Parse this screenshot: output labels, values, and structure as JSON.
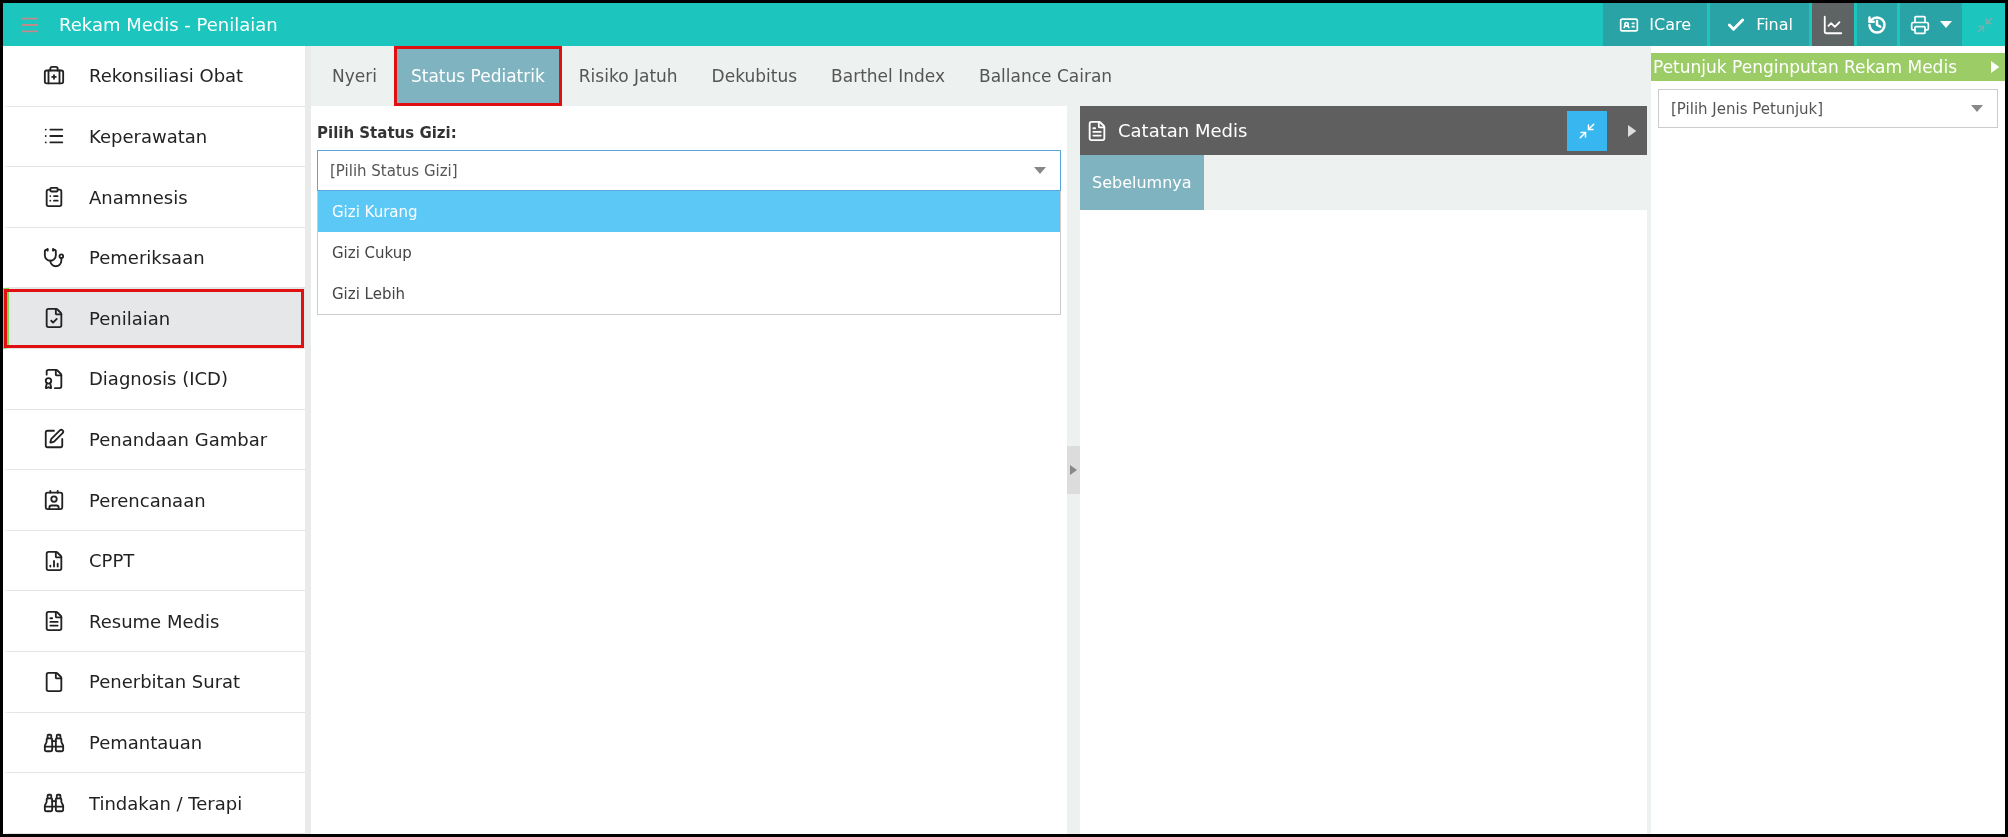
{
  "header": {
    "title": "Rekam Medis - Penilaian",
    "actions": [
      {
        "kind": "icare",
        "label": "ICare",
        "selected": false,
        "disabled": false
      },
      {
        "kind": "final",
        "label": "Final",
        "selected": false,
        "disabled": false
      },
      {
        "kind": "chart",
        "selected": true,
        "disabled": false
      },
      {
        "kind": "history",
        "selected": false,
        "disabled": false
      },
      {
        "kind": "print",
        "selected": false,
        "disabled": false
      },
      {
        "kind": "collapse",
        "selected": false,
        "disabled": true
      }
    ]
  },
  "sidebar": {
    "items": [
      {
        "label": "Rekonsiliasi Obat",
        "selected": false
      },
      {
        "label": "Keperawatan",
        "selected": false
      },
      {
        "label": "Anamnesis",
        "selected": false
      },
      {
        "label": "Pemeriksaan",
        "selected": false
      },
      {
        "label": "Penilaian",
        "selected": true
      },
      {
        "label": "Diagnosis (ICD)",
        "selected": false
      },
      {
        "label": "Penandaan Gambar",
        "selected": false
      },
      {
        "label": "Perencanaan",
        "selected": false
      },
      {
        "label": "CPPT",
        "selected": false
      },
      {
        "label": "Resume Medis",
        "selected": false
      },
      {
        "label": "Penerbitan Surat",
        "selected": false
      },
      {
        "label": "Pemantauan",
        "selected": false
      },
      {
        "label": "Tindakan / Terapi",
        "selected": false
      }
    ]
  },
  "tabs": [
    {
      "label": "Nyeri",
      "selected": false
    },
    {
      "label": "Status Pediatrik",
      "selected": true
    },
    {
      "label": "Risiko Jatuh",
      "selected": false
    },
    {
      "label": "Dekubitus",
      "selected": false
    },
    {
      "label": "Barthel Index",
      "selected": false
    },
    {
      "label": "Ballance Cairan",
      "selected": false
    }
  ],
  "form": {
    "label": "Pilih Status Gizi:",
    "select": {
      "placeholder": "[Pilih Status Gizi]",
      "options": [
        {
          "label": "Gizi Kurang",
          "selected": true
        },
        {
          "label": "Gizi Cukup",
          "selected": false
        },
        {
          "label": "Gizi Lebih",
          "selected": false
        }
      ]
    }
  },
  "notes_panel": {
    "title": "Catatan Medis",
    "tabs": [
      {
        "label": "Sebelumnya",
        "selected": true
      }
    ]
  },
  "guide_panel": {
    "title": "Petunjuk Penginputan Rekam Medis",
    "select": {
      "placeholder": "[Pilih Jenis Petunjuk]"
    }
  }
}
